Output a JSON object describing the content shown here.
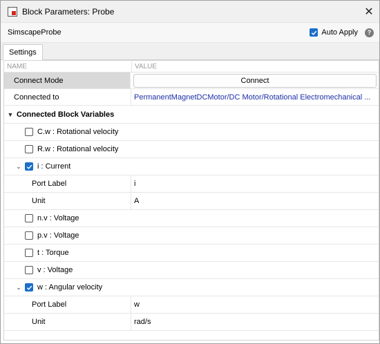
{
  "window": {
    "title": "Block Parameters: Probe"
  },
  "header": {
    "block_name": "SimscapeProbe",
    "auto_apply_label": "Auto Apply",
    "auto_apply_checked": true
  },
  "tabs": [
    {
      "label": "Settings"
    }
  ],
  "grid": {
    "col_name": "NAME",
    "col_value": "VALUE",
    "connect_mode": {
      "label": "Connect Mode",
      "button": "Connect"
    },
    "connected_to": {
      "label": "Connected to",
      "value": "PermanentMagnetDCMotor/DC Motor/Rotational Electromechanical ..."
    },
    "group_label": "Connected Block Variables",
    "variables": [
      {
        "label": "C.w : Rotational velocity",
        "checked": false,
        "expanded": false
      },
      {
        "label": "R.w : Rotational velocity",
        "checked": false,
        "expanded": false
      },
      {
        "label": "i : Current",
        "checked": true,
        "expanded": true,
        "port_label_name": "Port Label",
        "port_label_value": "i",
        "unit_name": "Unit",
        "unit_value": "A"
      },
      {
        "label": "n.v : Voltage",
        "checked": false,
        "expanded": false
      },
      {
        "label": "p.v : Voltage",
        "checked": false,
        "expanded": false
      },
      {
        "label": "t : Torque",
        "checked": false,
        "expanded": false
      },
      {
        "label": "v : Voltage",
        "checked": false,
        "expanded": false
      },
      {
        "label": "w : Angular velocity",
        "checked": true,
        "expanded": true,
        "port_label_name": "Port Label",
        "port_label_value": "w",
        "unit_name": "Unit",
        "unit_value": "rad/s"
      }
    ]
  },
  "colors": {
    "accent": "#1a6fc9",
    "link": "#1c2fa8"
  }
}
